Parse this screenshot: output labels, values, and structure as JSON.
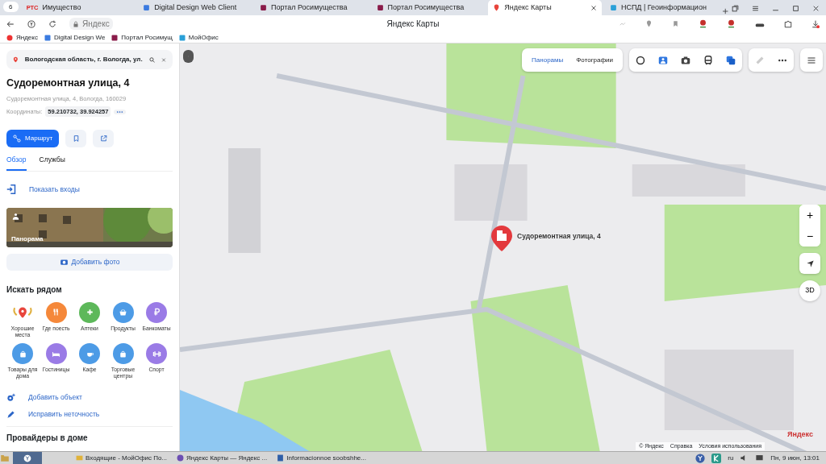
{
  "browser": {
    "tab_count": "6",
    "tabs": [
      {
        "label": "Имущество",
        "favicon": "РТС",
        "selected": false
      },
      {
        "label": "Digital Design Web Client",
        "selected": false
      },
      {
        "label": "Портал Росимущества",
        "selected": false
      },
      {
        "label": "Портал Росимущества",
        "selected": false
      },
      {
        "label": "Яндекс Карты",
        "selected": true
      },
      {
        "label": "НСПД | Геоинформацион",
        "selected": false
      }
    ],
    "address": "Яндекс",
    "page_title": "Яндекс Карты",
    "bookmarks": [
      "Яндекс",
      "Digital Design We",
      "Портал Росимущ",
      "МойОфис"
    ]
  },
  "panel": {
    "search": "Вологодская область, г. Вологда, ул.",
    "title": "Судоремонтная улица, 4",
    "address": "Судоремонтная улица, 4, Вологда, 160029",
    "coords_label": "Координаты:",
    "coords": "59.210732, 39.924257",
    "route_button": "Маршрут",
    "tabs": [
      {
        "label": "Обзор",
        "selected": true
      },
      {
        "label": "Службы",
        "selected": false
      }
    ],
    "show_entrances": "Показать входы",
    "panorama_label": "Панорама",
    "add_photo": "Добавить фото",
    "nearby_title": "Искать рядом",
    "nearby": [
      {
        "label": "Хорошие места",
        "kind": "laurel",
        "color": "#e8453c"
      },
      {
        "label": "Где поесть",
        "kind": "fork",
        "color": "#f5883a"
      },
      {
        "label": "Аптеки",
        "kind": "cross",
        "color": "#5db85a"
      },
      {
        "label": "Продукты",
        "kind": "basket",
        "color": "#4d9be6"
      },
      {
        "label": "Банкоматы",
        "kind": "ruble",
        "color": "#9a7be6"
      },
      {
        "label": "Товары для дома",
        "kind": "bag",
        "color": "#4d9be6"
      },
      {
        "label": "Гостиницы",
        "kind": "bed",
        "color": "#9a7be6"
      },
      {
        "label": "Кафе",
        "kind": "cup",
        "color": "#4d9be6"
      },
      {
        "label": "Торговые центры",
        "kind": "bag",
        "color": "#4d9be6"
      },
      {
        "label": "Спорт",
        "kind": "dumbbell",
        "color": "#9a7be6"
      }
    ],
    "actions": [
      {
        "label": "Добавить объект",
        "kind": "add"
      },
      {
        "label": "Исправить неточность",
        "kind": "edit"
      }
    ],
    "providers_title": "Провайдеры в доме"
  },
  "map": {
    "layers": [
      {
        "label": "Панорамы",
        "selected": true
      },
      {
        "label": "Фотографии",
        "selected": false
      }
    ],
    "marker_label": "Судоремонтная улица, 4",
    "zoom_in": "+",
    "zoom_out": "−",
    "view_3d": "3D",
    "attribution": [
      "© Яндекс",
      "Справка",
      "Условия использования"
    ],
    "logo": "Яндекс"
  },
  "taskbar": {
    "windows": [
      "Входящие - МойОфис По...",
      "Яндекс Карты — Яндекс ...",
      "Informacionnoe soobshhe..."
    ],
    "lang": "ru",
    "clock": "Пн, 9 июн, 13:01"
  }
}
